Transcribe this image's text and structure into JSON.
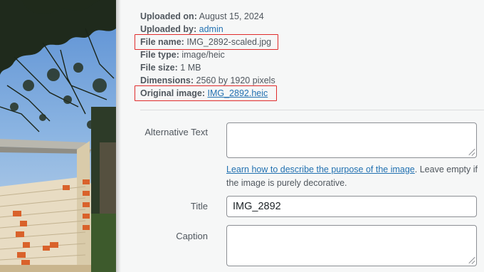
{
  "details": {
    "uploaded_on": {
      "label": "Uploaded on:",
      "value": "August 15, 2024"
    },
    "uploaded_by": {
      "label": "Uploaded by:",
      "value": "admin"
    },
    "file_name": {
      "label": "File name:",
      "value": "IMG_2892-scaled.jpg"
    },
    "file_type": {
      "label": "File type:",
      "value": "image/heic"
    },
    "file_size": {
      "label": "File size:",
      "value": "1 MB"
    },
    "dimensions": {
      "label": "Dimensions:",
      "value": "2560 by 1920 pixels"
    },
    "original_image": {
      "label": "Original image:",
      "value": "IMG_2892.heic"
    }
  },
  "form": {
    "alt_text": {
      "label": "Alternative Text",
      "value": "",
      "help_link": "Learn how to describe the purpose of the image",
      "help_text": ". Leave empty if the image is purely decorative."
    },
    "title": {
      "label": "Title",
      "value": "IMG_2892"
    },
    "caption": {
      "label": "Caption",
      "value": ""
    }
  },
  "colors": {
    "link": "#2271b1",
    "highlight": "#e02b2b",
    "panel_bg": "#f6f7f7"
  }
}
